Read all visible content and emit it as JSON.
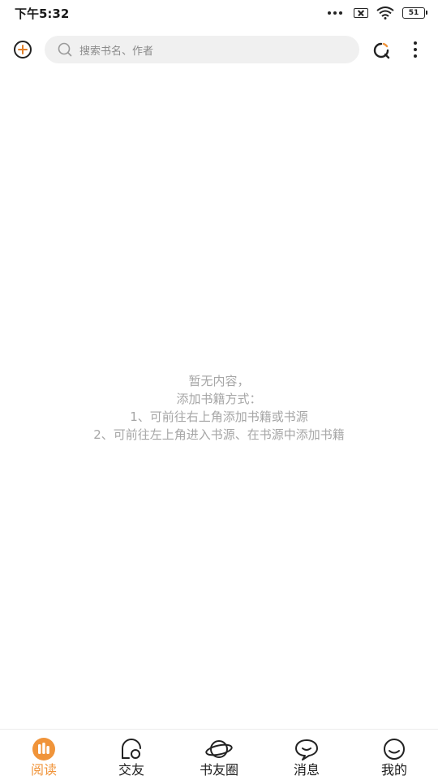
{
  "status_bar": {
    "time": "下午5:32",
    "battery": "51"
  },
  "toolbar": {
    "search_placeholder": "搜索书名、作者"
  },
  "empty_state": {
    "lines": [
      "暂无内容，",
      "添加书籍方式：",
      "1、可前往右上角添加书籍或书源",
      "2、可前往左上角进入书源、在书源中添加书籍"
    ]
  },
  "bottom_nav": {
    "items": [
      {
        "label": "阅读",
        "icon": "read-icon",
        "active": true
      },
      {
        "label": "交友",
        "icon": "friends-icon",
        "active": false
      },
      {
        "label": "书友圈",
        "icon": "planet-icon",
        "active": false
      },
      {
        "label": "消息",
        "icon": "message-icon",
        "active": false
      },
      {
        "label": "我的",
        "icon": "profile-icon",
        "active": false
      }
    ]
  },
  "colors": {
    "accent": "#f0943a",
    "placeholder_text": "#a6a6a6",
    "search_bg": "#f0f0f0"
  }
}
